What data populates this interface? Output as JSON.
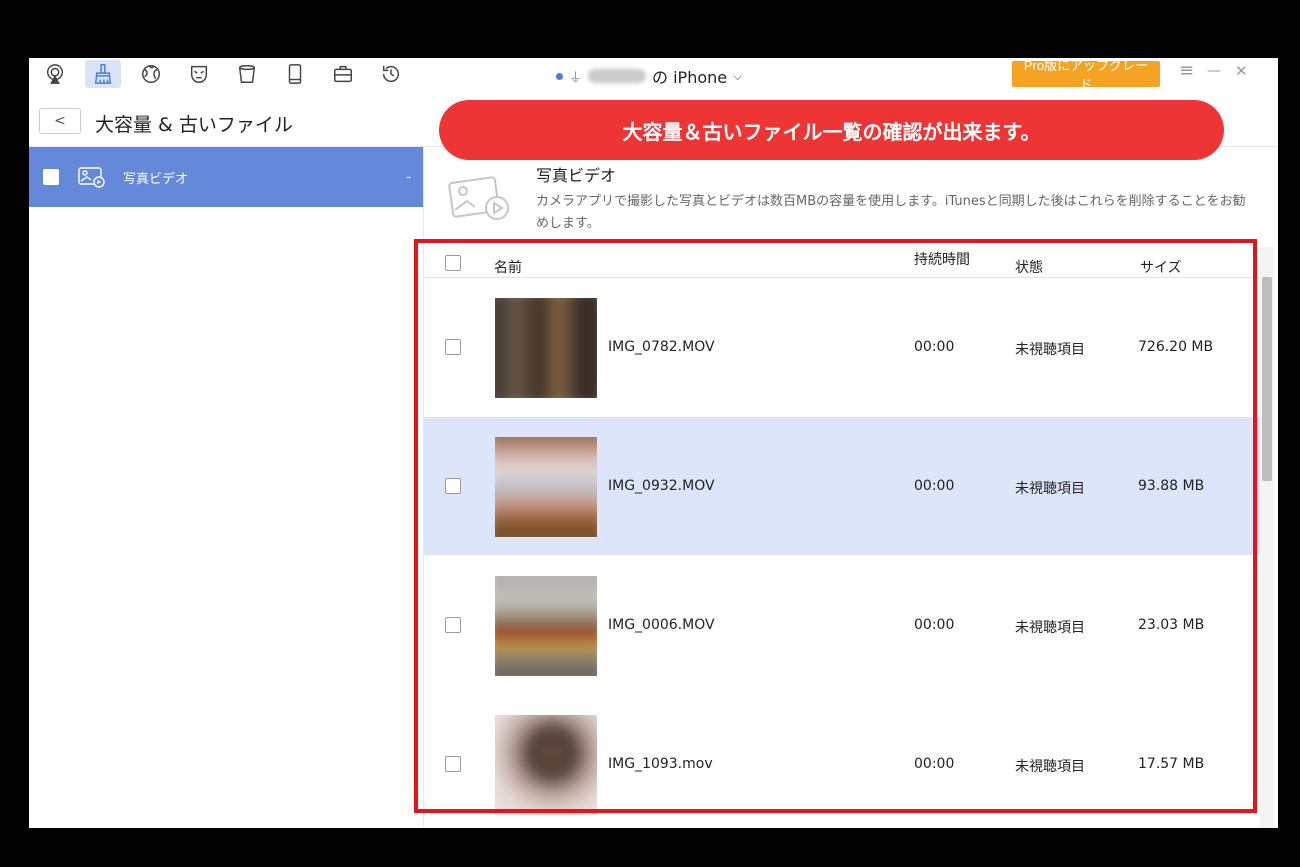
{
  "toolbar": {
    "tools": [
      {
        "name": "airplay-icon",
        "active": false
      },
      {
        "name": "cleaner-brush-icon",
        "active": true
      },
      {
        "name": "globe-icon",
        "active": false
      },
      {
        "name": "mask-icon",
        "active": false
      },
      {
        "name": "trash-bin-icon",
        "active": false
      },
      {
        "name": "tablet-icon",
        "active": false
      },
      {
        "name": "toolbox-icon",
        "active": false
      },
      {
        "name": "history-icon",
        "active": false
      }
    ],
    "device_suffix": "の iPhone",
    "upgrade_label": "Pro版にアップグレード",
    "menu_glyph": "≡",
    "minimize_glyph": "—",
    "close_glyph": "✕"
  },
  "header": {
    "back_glyph": "<",
    "title": "大容量 & 古いファイル"
  },
  "banner": {
    "text": "大容量＆古いファイル一覧の確認が出来ます。",
    "color": "#ee3535"
  },
  "sidebar": {
    "items": [
      {
        "label": "写真ビデオ",
        "count": "-",
        "selected": true
      }
    ]
  },
  "info": {
    "title": "写真ビデオ",
    "description": "カメラアプリで撮影した写真とビデオは数百MBの容量を使用します。iTunesと同期した後はこれらを削除することをお勧めします。"
  },
  "table": {
    "headers": {
      "name": "名前",
      "duration": "持続時間",
      "status": "状態",
      "size": "サイズ"
    },
    "rows": [
      {
        "name": "IMG_0782.MOV",
        "duration": "00:00",
        "status": "未視聴項目",
        "size": "726.20 MB",
        "selected": false
      },
      {
        "name": "IMG_0932.MOV",
        "duration": "00:00",
        "status": "未視聴項目",
        "size": "93.88 MB",
        "selected": true
      },
      {
        "name": "IMG_0006.MOV",
        "duration": "00:00",
        "status": "未視聴項目",
        "size": "23.03 MB",
        "selected": false
      },
      {
        "name": "IMG_1093.mov",
        "duration": "00:00",
        "status": "未視聴項目",
        "size": "17.57 MB",
        "selected": false
      }
    ]
  },
  "colors": {
    "accent": "#6589da",
    "selected_row": "#dce5fa",
    "upgrade": "#f5a324",
    "highlight_frame": "#e8121b"
  }
}
